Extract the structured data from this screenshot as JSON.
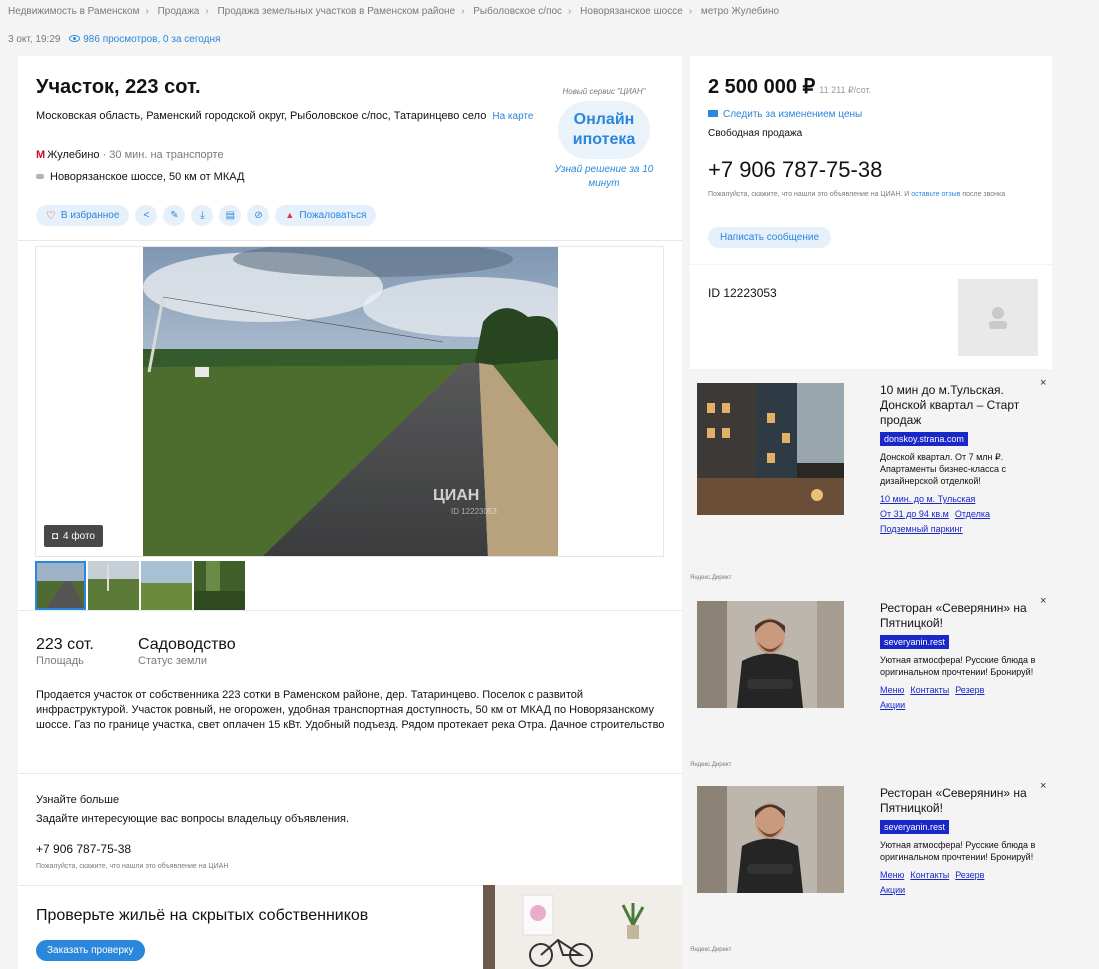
{
  "breadcrumbs": [
    "Недвижимость в Раменском",
    "Продажа",
    "Продажа земельных участков в Раменском районе",
    "Рыболовское с/пос",
    "Новорязанское шоссе",
    "метро Жулебино"
  ],
  "meta": {
    "date": "3 окт, 19:29",
    "views": "986 просмотров, 0 за сегодня"
  },
  "listing": {
    "title": "Участок, 223 сот.",
    "address": "Московская область, Раменский городской округ, Рыболовское с/пос, Татаринцево село",
    "map_link": "На карте",
    "metro_name": "Жулебино",
    "metro_time": "· 30 мин. на транспорте",
    "highway": "Новорязанское шоссе, 50 км от МКАД"
  },
  "actions": {
    "favorite": "В избранное",
    "report": "Пожаловаться"
  },
  "promo": {
    "small": "Новый сервис \"ЦИАН\"",
    "line1": "Онлайн",
    "line2": "ипотека",
    "link": "Узнай решение за 10 минут"
  },
  "gallery": {
    "badge": "4 фото",
    "watermark": "ЦИАН",
    "watermark_id": "ID 12223053"
  },
  "stats": [
    {
      "value": "223 сот.",
      "label": "Площадь"
    },
    {
      "value": "Садоводство",
      "label": "Статус земли"
    }
  ],
  "description": "Продается участок от собственника 223 сотки в Раменском районе, дер. Татаринцево. Поселок с развитой инфраструктурой. Участок ровный, не огорожен, удобная транспортная доступность, 50 км от МКАД по Новорязанскому шоссе. Газ по границе участка, свет оплачен 15 кВт. Удобный подъезд. Рядом протекает река Отра. Дачное строительство",
  "learn_more": {
    "title": "Узнайте больше",
    "subtitle": "Задайте интересующие вас вопросы владельцу объявления.",
    "phone": "+7 906 787-75-38",
    "note": "Пожалуйста, скажите, что нашли это объявление на ЦИАН"
  },
  "check": {
    "title": "Проверьте жильё на скрытых собственников",
    "button": "Заказать проверку"
  },
  "price_block": {
    "price": "2 500 000 ₽",
    "per": "11 211 ₽/сот.",
    "follow": "Следить за изменением цены",
    "sale_type": "Свободная продажа",
    "phone": "+7 906 787-75-38",
    "note": "Пожалуйста, скажите, что нашли это объявление на ЦИАН. И",
    "note_link": "оставьте отзыв",
    "note_end": "после звонка",
    "message_button": "Написать сообщение"
  },
  "object_id": "ID 12223053",
  "ads": [
    {
      "headline": "10 мин до м.Тульская. Донской квартал – Старт продаж",
      "domain": "donskoy.strana.com",
      "body": "Донской квартал. От 7 млн ₽. Апартаменты бизнес-класса с дизайнерской отделкой!",
      "links": [
        "10 мин. до м. Тульская",
        "От 31 до 94 кв.м",
        "Отделка",
        "Подземный паркинг"
      ],
      "source": "Яндекс.Директ",
      "close": "×"
    },
    {
      "headline": "Ресторан «Северянин» на Пятницкой!",
      "domain": "severyanin.rest",
      "body": "Уютная атмосфера! Русские блюда в оригинальном прочтении! Бронируй!",
      "links": [
        "Меню",
        "Контакты",
        "Резерв",
        "Акции"
      ],
      "source": "Яндекс.Директ",
      "close": "×"
    },
    {
      "headline": "Ресторан «Северянин» на Пятницкой!",
      "domain": "severyanin.rest",
      "body": "Уютная атмосфера! Русские блюда в оригинальном прочтении! Бронируй!",
      "links": [
        "Меню",
        "Контакты",
        "Резерв",
        "Акции"
      ],
      "source": "Яндекс.Директ",
      "close": "×"
    }
  ],
  "colors": {
    "accent": "#2b87db",
    "metro": "#c8102e",
    "ad_link": "#1a27c9"
  }
}
